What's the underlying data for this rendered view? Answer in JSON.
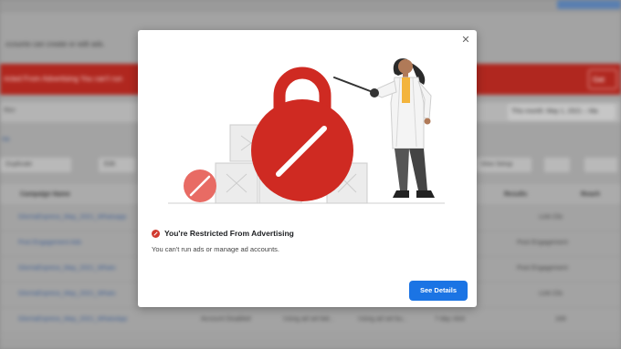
{
  "background": {
    "banner_text": "ricted From Advertising   You can't run",
    "banner_button": "Get",
    "subtext": "ccounts can create or edit ads.",
    "filter_text": "filter",
    "date_range": "This month: May 1, 2021 – Ma",
    "tab_link": "ns",
    "toolbar": {
      "duplicate": "Duplicate",
      "edit": "Edit",
      "view_setup": "View Setup"
    },
    "headers": {
      "campaign_name": "Campaign Name",
      "results": "Results",
      "reach": "Reach"
    },
    "rows": [
      {
        "name": "GlorriaExpress_May_2021_Whatsapp",
        "delivery": "",
        "bid": "",
        "budget": "",
        "attribution": "",
        "results": "Link Clic"
      },
      {
        "name": "Post Engagement Ads",
        "delivery": "",
        "bid": "",
        "budget": "",
        "attribution": "",
        "results": "Post Engagement"
      },
      {
        "name": "GlorriaExpress_May_2021_Whats",
        "delivery": "",
        "bid": "",
        "budget": "",
        "attribution": "",
        "results": "Post Engagement"
      },
      {
        "name": "GlorriaExpress_May_2021_Whats",
        "delivery": "",
        "bid": "",
        "budget": "",
        "attribution": "",
        "results": "Link Clic"
      },
      {
        "name": "GlorriaExpress_May_2021_WhatsApp",
        "delivery": "Account Disabled",
        "bid": "Using ad set bid...",
        "budget": "Using ad set bu...",
        "attribution": "7-day click",
        "results": "169"
      }
    ]
  },
  "modal": {
    "title": "You're Restricted From Advertising",
    "description": "You can't run ads or manage ad accounts.",
    "button_label": "See Details",
    "close_glyph": "✕"
  },
  "colors": {
    "accent": "#1b74e4",
    "alert_red": "#d13a2f",
    "banner_red": "#b0271f"
  }
}
